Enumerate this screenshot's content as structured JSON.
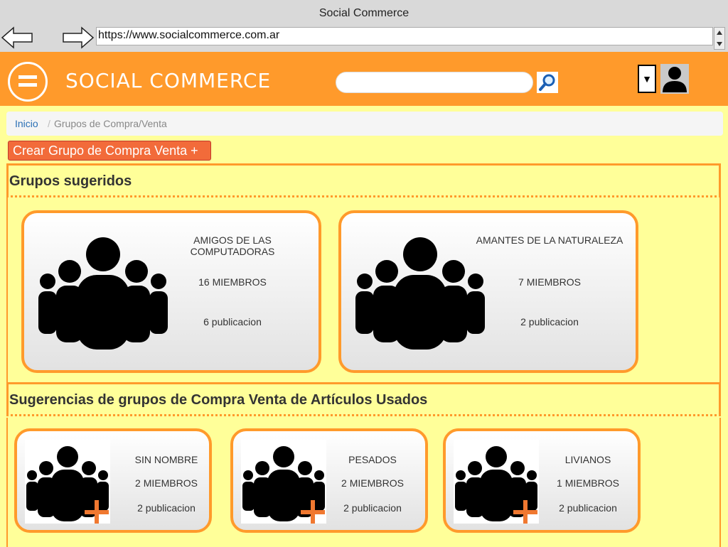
{
  "browser": {
    "title": "Social Commerce",
    "url": "https://www.socialcommerce.com.ar"
  },
  "header": {
    "brand": "SOCIAL COMMERCE",
    "search_placeholder": "",
    "dropdown_glyph": "▼",
    "accent_color": "#ff9a2b"
  },
  "breadcrumb": {
    "home": "Inicio",
    "separator": "/",
    "current": "Grupos de Compra/Venta"
  },
  "actions": {
    "create_group": "Crear Grupo de Compra Venta +"
  },
  "suggested": {
    "title": "Grupos sugeridos",
    "cards": [
      {
        "name": "AMIGOS DE LAS COMPUTADORAS",
        "members": "16 MIEMBROS",
        "posts": "6 publicacion",
        "icon": "group-icon"
      },
      {
        "name": "AMANTES DE LA NATURALEZA",
        "members": "7 MIEMBROS",
        "posts": "2 publicacion",
        "icon": "group-icon"
      }
    ]
  },
  "used_items": {
    "title": "Sugerencias de grupos de Compra Venta de Artículos Usados",
    "cards": [
      {
        "name": "SIN NOMBRE",
        "members": "2 MIEMBROS",
        "posts": "2 publicacion",
        "icon": "group-add-icon"
      },
      {
        "name": "PESADOS",
        "members": "2 MIEMBROS",
        "posts": "2 publicacion",
        "icon": "group-add-icon"
      },
      {
        "name": "LIVIANOS",
        "members": "1 MIEMBROS",
        "posts": "2 publicacion",
        "icon": "group-add-icon"
      }
    ]
  }
}
